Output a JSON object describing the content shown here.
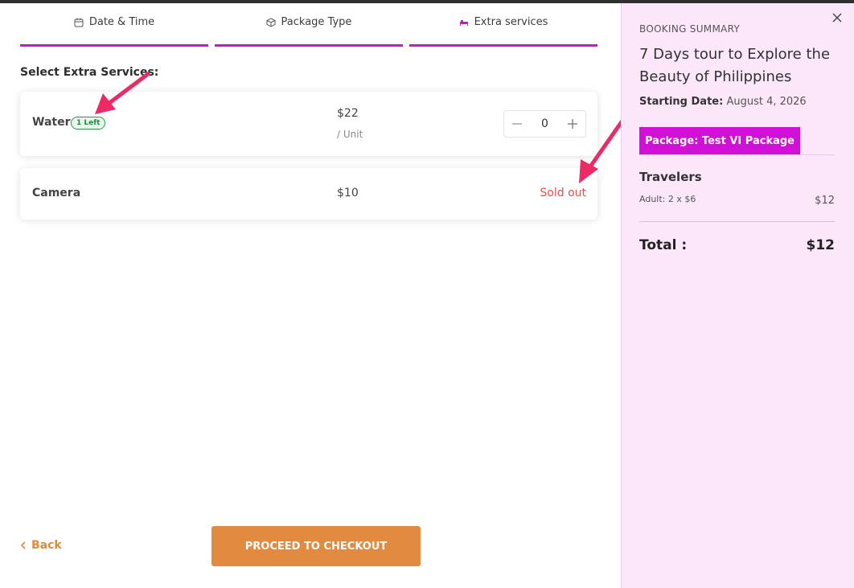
{
  "steps": [
    {
      "label": "Date & Time",
      "icon": "calendar-icon"
    },
    {
      "label": "Package Type",
      "icon": "box-icon"
    },
    {
      "label": "Extra services",
      "icon": "bed-icon"
    }
  ],
  "main": {
    "section_title": "Select Extra Services:",
    "services": [
      {
        "name": "Water",
        "badge": "1 Left",
        "price": "$22",
        "unit": "/ Unit",
        "quantity": "0"
      },
      {
        "name": "Camera",
        "price": "$10",
        "status": "Sold out"
      }
    ],
    "back_label": "Back",
    "checkout_label": "PROCEED TO CHECKOUT"
  },
  "summary": {
    "heading": "BOOKING SUMMARY",
    "tour_title": "7 Days tour to Explore the Beauty of Philippines",
    "starting_date_label": "Starting Date:",
    "starting_date_value": "August 4, 2026",
    "package": "Package: Test VI Package",
    "travelers_heading": "Travelers",
    "adult_line": "Adult: 2 x $6",
    "adult_amount": "$12",
    "total_label": "Total :",
    "total_amount": "$12"
  },
  "colors": {
    "accent_magenta": "#d10fd6",
    "checkout_orange": "#e28b40",
    "sold_out_red": "#ee4b4b",
    "badge_green": "#1f8a3c",
    "sidebar_bg": "#fbe6fa",
    "annotation_arrow": "#ee2a66"
  }
}
